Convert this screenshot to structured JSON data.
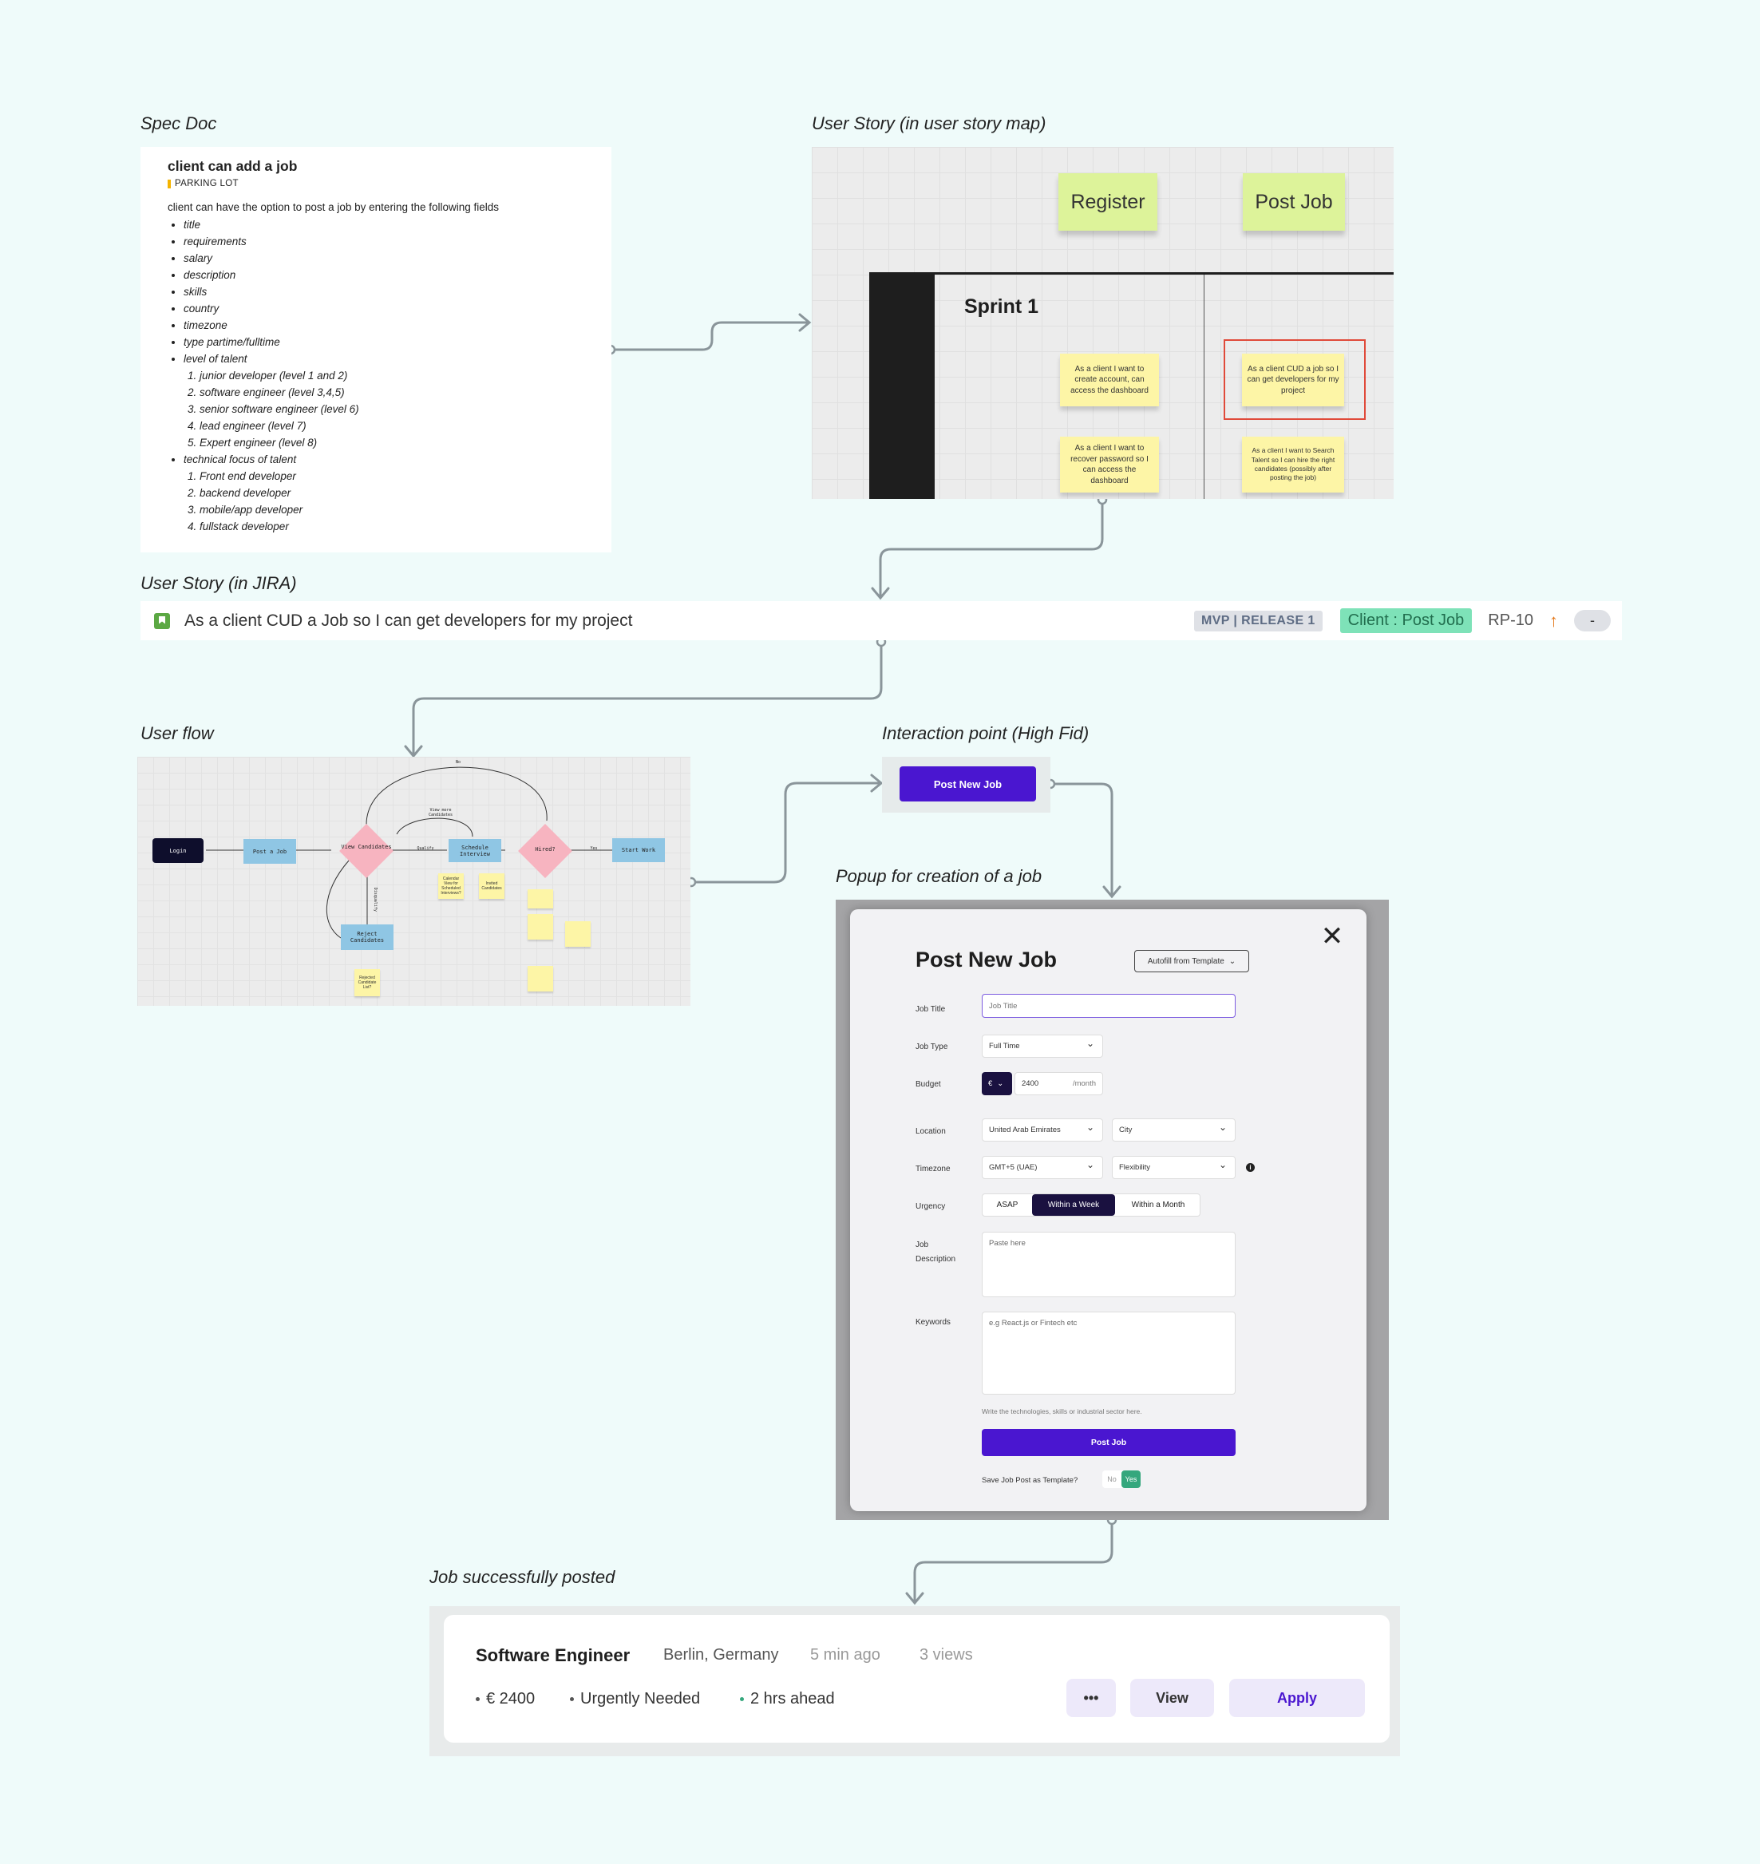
{
  "labels": {
    "spec_doc": "Spec Doc",
    "story_map": "User Story (in user story map)",
    "jira": "User Story (in JIRA)",
    "user_flow": "User flow",
    "interaction": "Interaction point (High Fid)",
    "popup": "Popup for creation of a job",
    "success": "Job successfully posted"
  },
  "spec_doc": {
    "title": "client can add a job",
    "tag": "PARKING LOT",
    "intro": "client can have the option to post a job by entering the following fields",
    "fields": [
      "title",
      "requirements",
      "salary",
      "description",
      "skills",
      "country",
      "timezone",
      "type partime/fulltime"
    ],
    "talent_level": {
      "label": "level of talent",
      "items": [
        "junior developer (level 1 and 2)",
        "software engineer (level 3,4,5)",
        "senior software engineer (level 6)",
        "lead engineer (level 7)",
        "Expert engineer (level 8)"
      ]
    },
    "tech_focus": {
      "label": "technical focus of talent",
      "items": [
        "Front end developer",
        "backend developer",
        "mobile/app developer",
        "fullstack developer"
      ]
    }
  },
  "story_map": {
    "epics": [
      "Register",
      "Post Job"
    ],
    "sprint": "Sprint 1",
    "stories": [
      "As a client I want to create account, can access the dashboard",
      "As a client CUD a job so I can get developers for my project",
      "As a client I want to recover password so I can access the dashboard",
      "As a client I want to Search Talent so I can hire the right candidates (possibly after posting the job)"
    ]
  },
  "jira": {
    "summary": "As a client CUD a Job so I can get developers for my project",
    "release": "MVP | RELEASE 1",
    "epic": "Client : Post Job",
    "key": "RP-10",
    "priority_icon": "arrow-up-icon",
    "status": "-",
    "colors": {
      "epic_bg": "#7ee2b8",
      "story_icon": "#5ba843",
      "priority": "#e57b1f"
    }
  },
  "user_flow": {
    "nodes": {
      "login": "Login",
      "post_job": "Post a Job",
      "view_candidates": "View Candidates",
      "schedule_interview": "Schedule Interview",
      "hired": "Hired?",
      "start_work": "Start Work",
      "reject_candidates": "Reject Candidates"
    },
    "edges": {
      "view_more": "View more Candidates",
      "qualify": "Qualify",
      "yes": "Yes",
      "no": "No",
      "disqualify": "Disqualify"
    },
    "notes": {
      "calendar": "Calendar View for Scheduled Interviews?",
      "invited": "Invited Candidates",
      "rejected": "Rejected Candidate List?"
    }
  },
  "interaction": {
    "button": "Post New Job",
    "color": "#4a16d0"
  },
  "popup": {
    "title": "Post New Job",
    "autofill": "Autofill from Template",
    "fields": {
      "job_title": {
        "label": "Job Title",
        "placeholder": "Job Title"
      },
      "job_type": {
        "label": "Job Type",
        "value": "Full Time"
      },
      "budget": {
        "label": "Budget",
        "currency": "€",
        "value": "2400",
        "unit": "/month"
      },
      "location": {
        "label": "Location",
        "country": "United Arab Emirates",
        "city": "City"
      },
      "timezone": {
        "label": "Timezone",
        "value": "GMT+5 (UAE)",
        "flexibility": "Flexibility"
      },
      "urgency": {
        "label": "Urgency",
        "options": [
          "ASAP",
          "Within a Week",
          "Within a Month"
        ],
        "selected": "Within a Week"
      },
      "description": {
        "label": "Job Description",
        "placeholder": "Paste here"
      },
      "keywords": {
        "label": "Keywords",
        "placeholder": "e.g React.js or Fintech etc",
        "hint": "Write the technologies, skills or industrial sector here."
      }
    },
    "submit": "Post Job",
    "template": {
      "label": "Save Job Post as Template?",
      "no": "No",
      "yes": "Yes",
      "selected": "Yes"
    }
  },
  "job_card": {
    "title": "Software Engineer",
    "location": "Berlin, Germany",
    "posted": "5 min ago",
    "views": "3 views",
    "budget": "€ 2400",
    "urgency": "Urgently Needed",
    "timezone_diff": "2 hrs ahead",
    "more": "•••",
    "view": "View",
    "apply": "Apply"
  }
}
